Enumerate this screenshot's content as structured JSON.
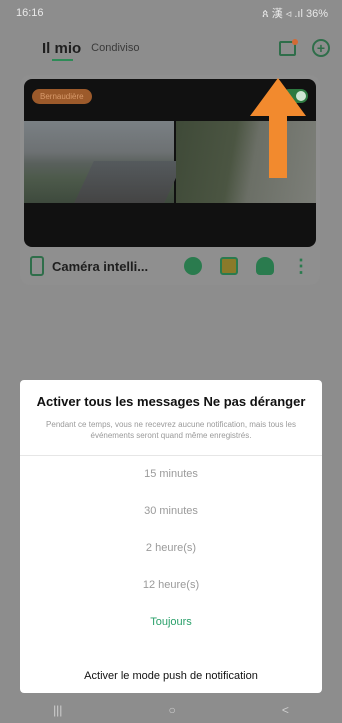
{
  "statusbar": {
    "time": "16:16",
    "icons": "ጰ 漢 ◃ .ıl 36%"
  },
  "header": {
    "tab_mine": "Il mio",
    "tab_shared": "Condiviso",
    "add_label": "+"
  },
  "card": {
    "badge": "Bernaudière",
    "camera_name": "Caméra intelli...",
    "more_label": "⋮"
  },
  "sheet": {
    "title": "Activer tous les messages Ne pas déranger",
    "description": "Pendant ce temps, vous ne recevrez aucune notification, mais tous les événements seront quand même enregistrés.",
    "options": [
      "15 minutes",
      "30 minutes",
      "2 heure(s)",
      "12 heure(s)",
      "Toujours"
    ],
    "footer": "Activer le mode push de notification"
  },
  "navbar": {
    "recent": "|||",
    "home": "○",
    "back": "<"
  },
  "colors": {
    "accent": "#2aa06a",
    "arrow": "#f28a2e",
    "brand_green": "#2f6e4a"
  }
}
